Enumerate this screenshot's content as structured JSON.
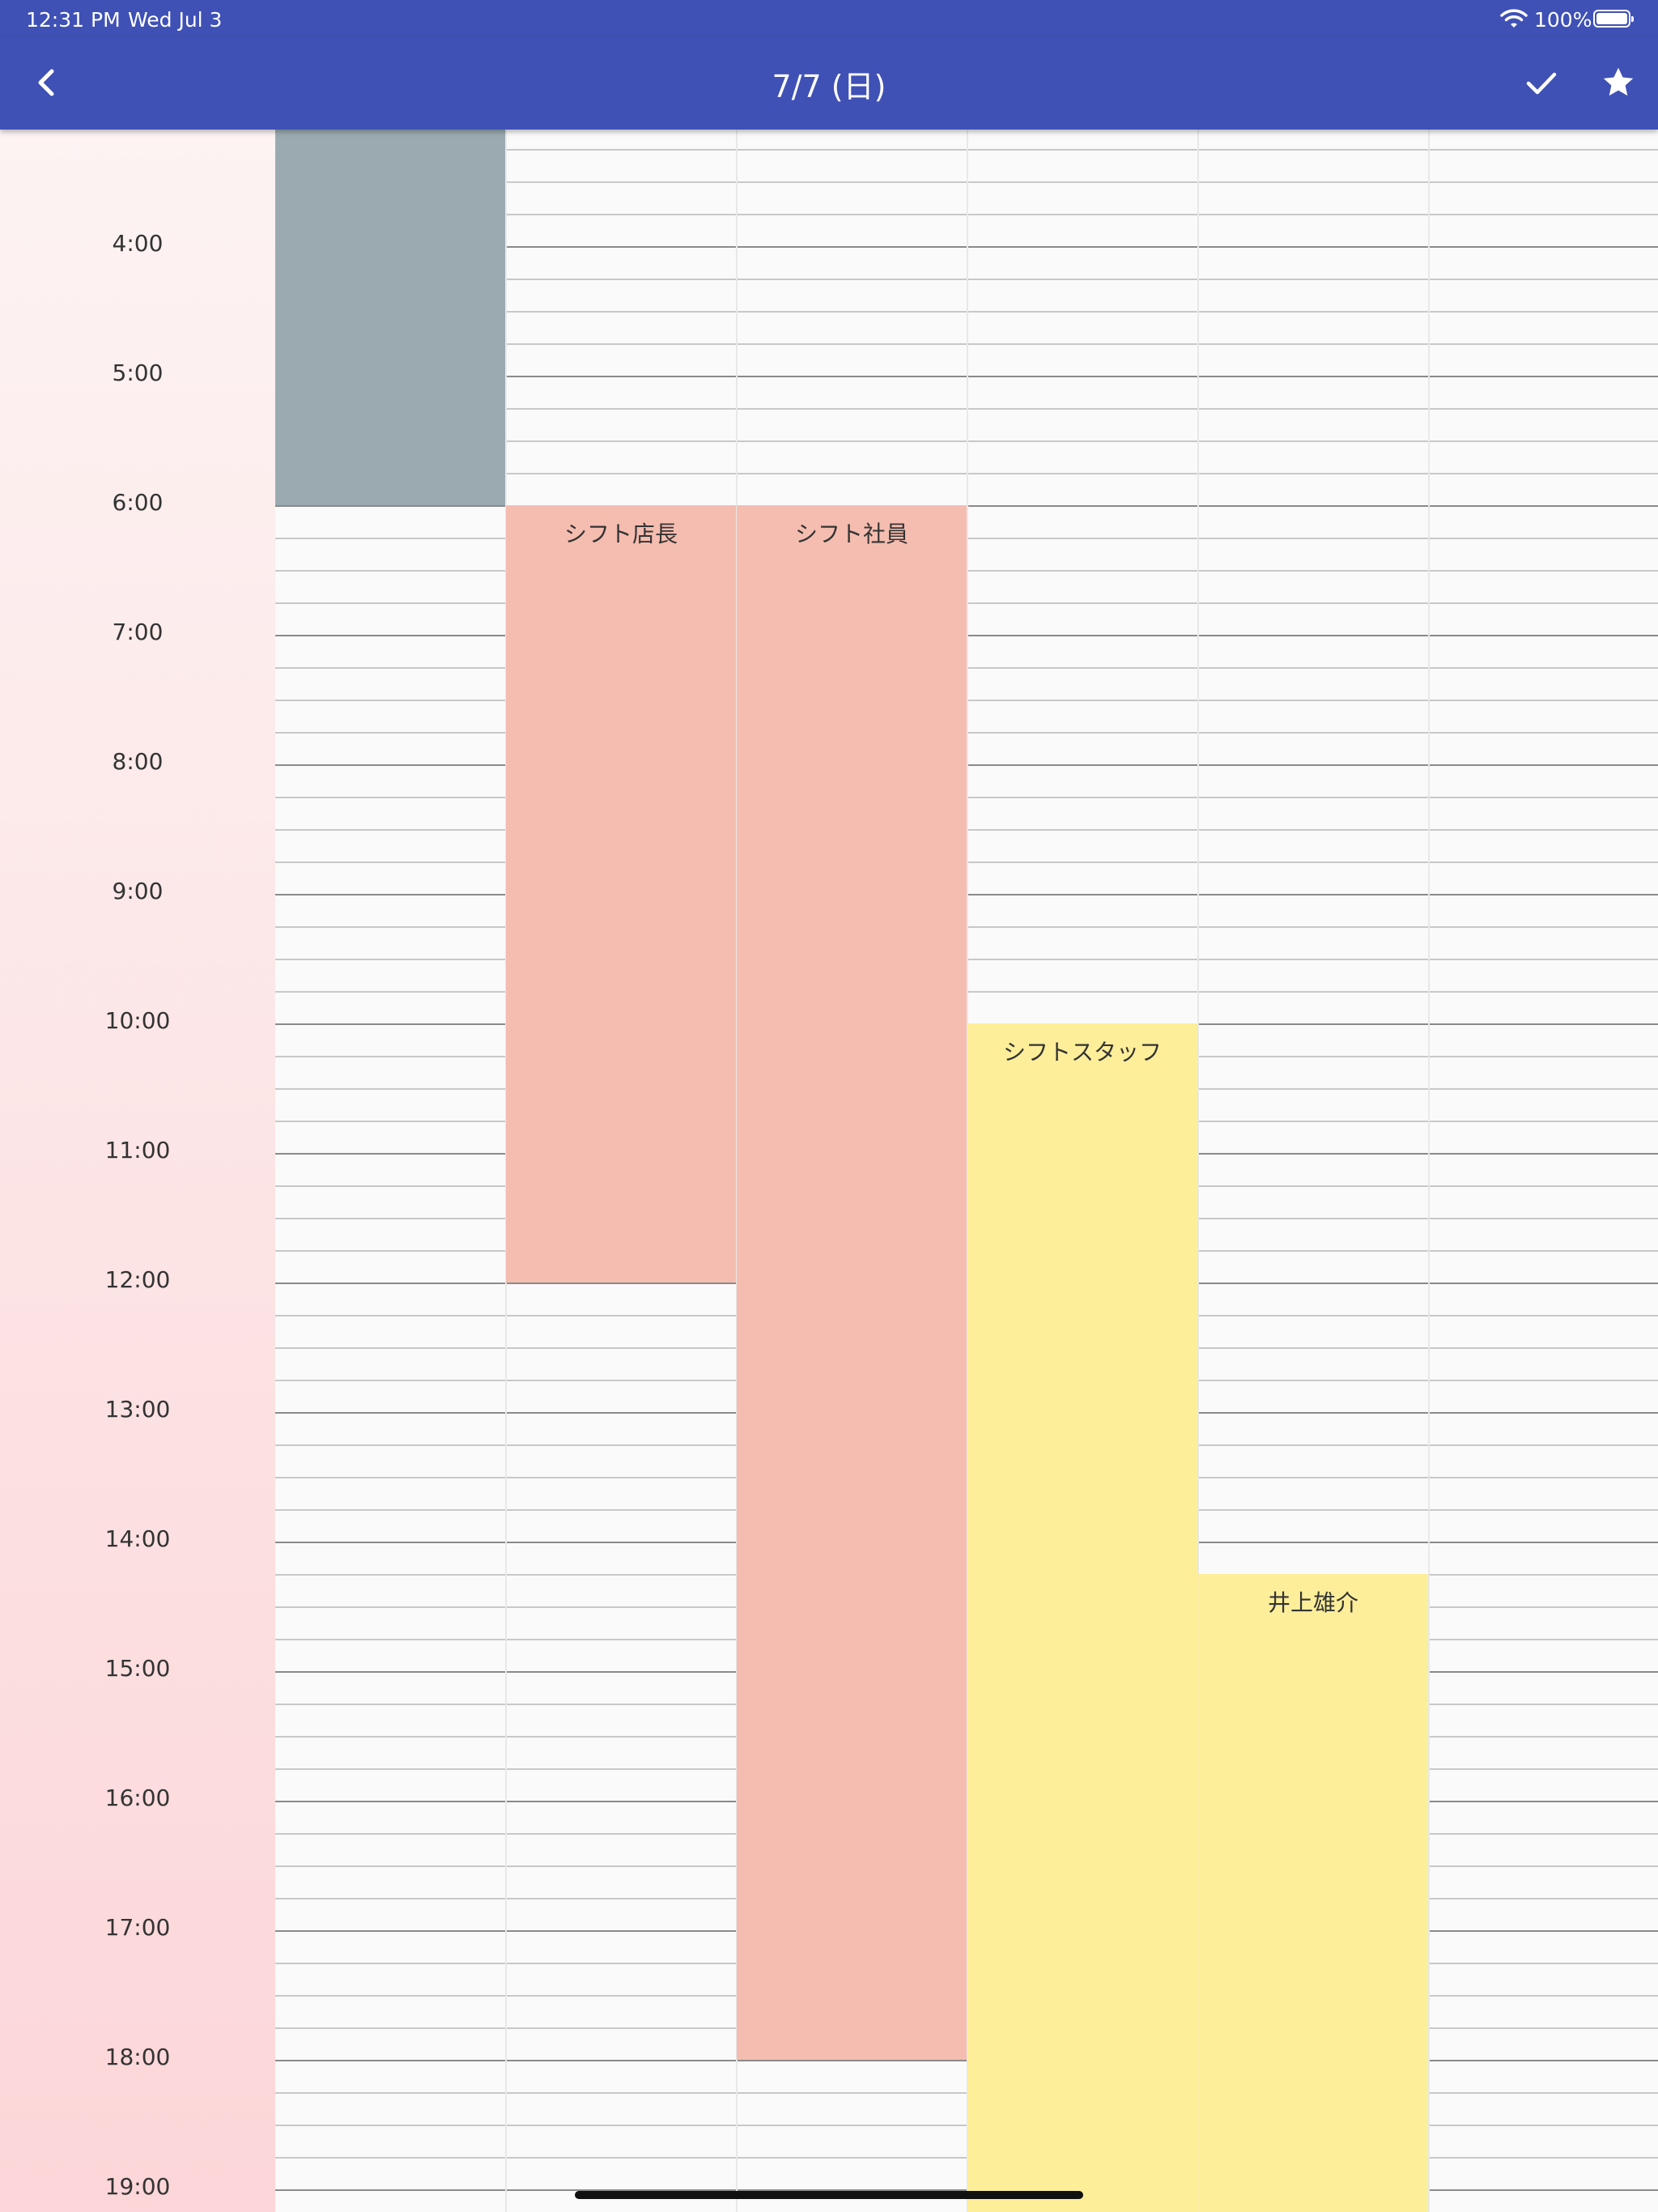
{
  "status_bar": {
    "time": "12:31 PM",
    "date": "Wed Jul 3",
    "battery": "100%"
  },
  "app_bar": {
    "title": "7/7 (日)",
    "back_icon": "chevron-left-icon",
    "check_icon": "check-icon",
    "star_icon": "star-icon"
  },
  "time_labels": [
    "4:00",
    "5:00",
    "6:00",
    "7:00",
    "8:00",
    "9:00",
    "10:00",
    "11:00",
    "12:00",
    "13:00",
    "14:00",
    "15:00",
    "16:00",
    "17:00",
    "18:00",
    "19:00"
  ],
  "shifts": [
    {
      "label": "",
      "column": 0,
      "start": "3:00",
      "end": "6:00",
      "color": "#9aaab0"
    },
    {
      "label": "シフト店長",
      "column": 1,
      "start": "6:00",
      "end": "12:00",
      "color": "#f4bdb0"
    },
    {
      "label": "シフト社員",
      "column": 2,
      "start": "6:00",
      "end": "18:00",
      "color": "#f4bdb0"
    },
    {
      "label": "シフトスタッフ",
      "column": 3,
      "start": "10:00",
      "end": "19:15",
      "color": "#fdee9a"
    },
    {
      "label": "井上雄介",
      "column": 4,
      "start": "14:15",
      "end": "19:15",
      "color": "#fdee9a"
    }
  ],
  "colors": {
    "app_bar": "#3f51b5",
    "time_column_top": "#fdf3f3",
    "time_column_bottom": "#fcd6d8"
  }
}
